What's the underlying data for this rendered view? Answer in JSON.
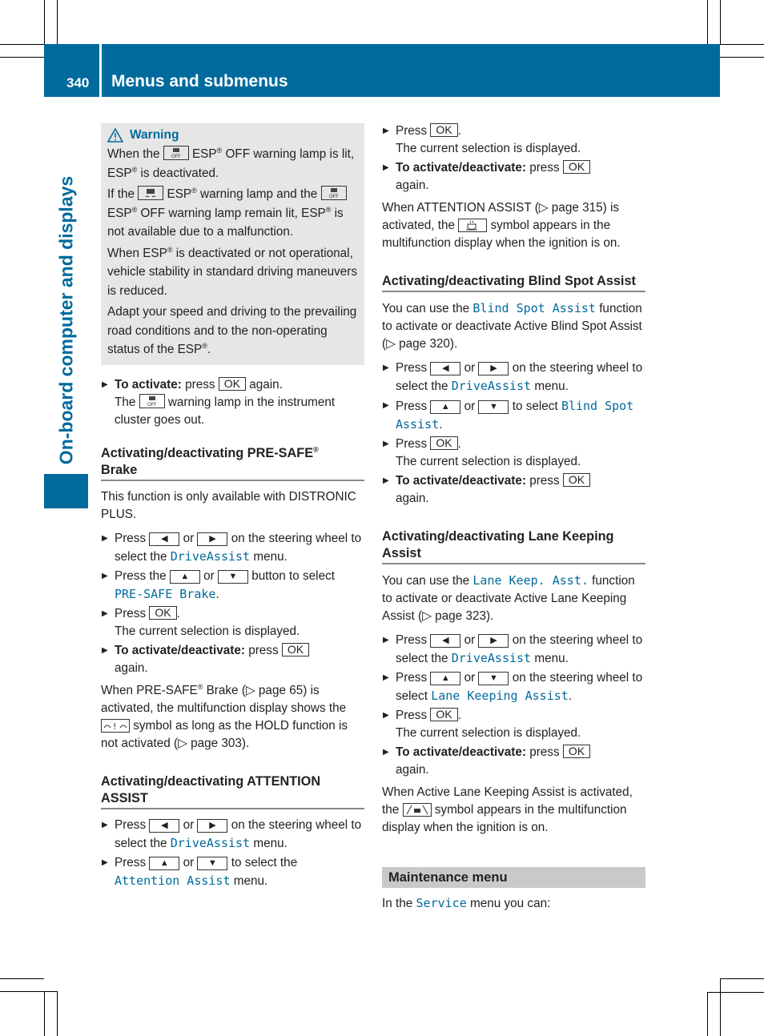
{
  "header": {
    "page_number": "340",
    "title": "Menus and submenus",
    "color": "#006a9c"
  },
  "side_label": "On-board computer and displays",
  "warning": {
    "title": "Warning",
    "p1_a": "When the",
    "p1_b": " ESP",
    "p1_c": " OFF warning lamp is lit,",
    "p1_d": "ESP",
    "p1_e": " is deactivated.",
    "p2_a": "If the",
    "p2_b": " ESP",
    "p2_c": " warning lamp and the",
    "p2_d": " ESP",
    "p2_e": " OFF warning lamp remain lit,",
    "p2_f": "ESP",
    "p2_g": " is not available due to a malfunction.",
    "p3_a": "When ESP",
    "p3_b": " is deactivated or not operational, vehicle stability in standard driving maneuvers is reduced.",
    "p4_a": "Adapt your speed and driving to the prevailing road conditions and to the non-operating status of the ESP",
    "p4_b": ".",
    "reg": "®"
  },
  "keys": {
    "ok": "OK",
    "left": "◀",
    "right": "▶",
    "up": "▲",
    "down": "▼"
  },
  "common": {
    "press": "Press",
    "press_the": "Press the",
    "or": "or",
    "on_steering_wheel": "on the steering wheel",
    "to_select_the": "to select the",
    "menu": "menu.",
    "button_to_select": "button to select",
    "to_select": "to select",
    "current_selection": "The current selection is displayed.",
    "to_activate_deactivate": "To activate/deactivate:",
    "press_lower": "press",
    "again": "again.",
    "drive_assist": "DriveAssist",
    "period": "."
  },
  "activate_step": {
    "label": "To activate:",
    "text_a": "press",
    "text_b": "again.",
    "line2_a": "The",
    "line2_b": "warning lamp in the instrument cluster goes out."
  },
  "presafe": {
    "heading_a": "Activating/deactivating PRE-SAFE",
    "heading_b": "Brake",
    "intro": "This function is only available with DISTRONIC PLUS.",
    "menu_item": "PRE-SAFE Brake",
    "note_a": "When PRE-SAFE",
    "note_b": " Brake (▷ page 65) is activated, the multifunction display shows the",
    "note_c": "symbol as long as the HOLD function is not activated (▷ page 303)."
  },
  "attention": {
    "heading": "Activating/deactivating ATTENTION ASSIST",
    "to_select_the": "to select the",
    "menu_item": "Attention Assist",
    "note_a": "When ATTENTION ASSIST (▷ page 315) is activated, the",
    "note_b": "symbol appears in the multifunction display when the ignition is on."
  },
  "blindspot": {
    "heading": "Activating/deactivating Blind Spot Assist",
    "intro_a": "You can use the",
    "function_name": "Blind Spot Assist",
    "intro_b": "function to activate or deactivate Active Blind Spot Assist (▷ page 320).",
    "menu_item": "Blind Spot Assist"
  },
  "lanekeeping": {
    "heading": "Activating/deactivating Lane Keeping Assist",
    "intro_a": "You can use the",
    "function_name": "Lane Keep. Asst.",
    "intro_b": "function to activate or deactivate Active Lane Keeping Assist (▷ page 323).",
    "menu_item": "Lane Keeping Assist",
    "note_a": "When Active Lane Keeping Assist is activated, the",
    "note_b": "symbol appears in the multifunction display when the ignition is on."
  },
  "maintenance": {
    "heading": "Maintenance menu",
    "text_a": "In the",
    "menu_name": "Service",
    "text_b": "menu you can:"
  }
}
